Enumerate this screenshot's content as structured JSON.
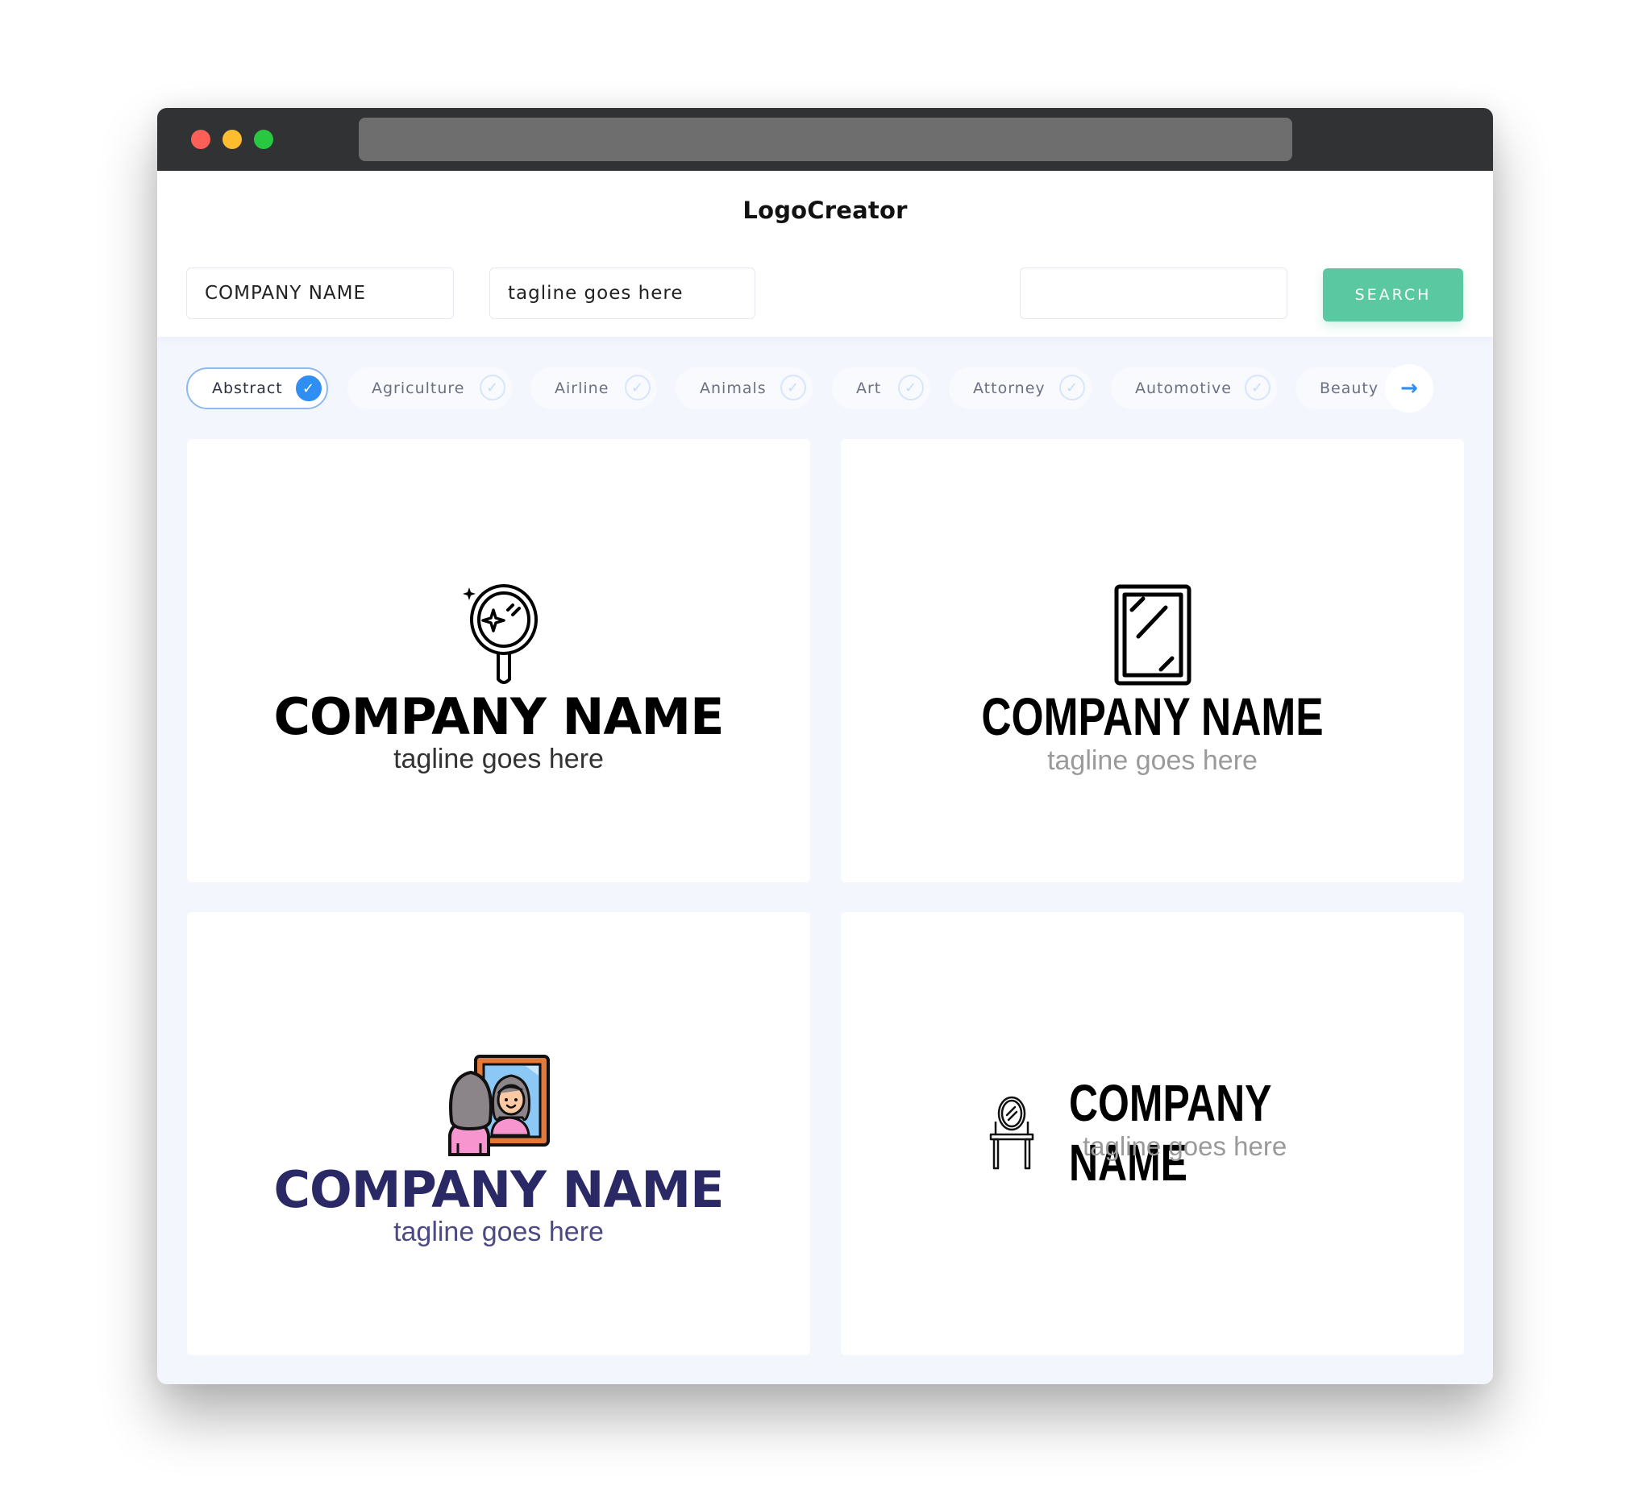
{
  "window": {
    "controls": [
      "close",
      "minimize",
      "maximize"
    ]
  },
  "header": {
    "brand": "LogoCreator"
  },
  "search": {
    "company_name_value": "COMPANY NAME",
    "tagline_value": "tagline goes here",
    "keyword_value": "",
    "search_label": "SEARCH"
  },
  "categories": {
    "items": [
      {
        "label": "Abstract",
        "selected": true
      },
      {
        "label": "Agriculture",
        "selected": false
      },
      {
        "label": "Airline",
        "selected": false
      },
      {
        "label": "Animals",
        "selected": false
      },
      {
        "label": "Art",
        "selected": false
      },
      {
        "label": "Attorney",
        "selected": false
      },
      {
        "label": "Automotive",
        "selected": false
      },
      {
        "label": "Beauty",
        "selected": false
      }
    ],
    "next_icon": "arrow-right-icon"
  },
  "logos": [
    {
      "icon": "hand-mirror-sparkle-icon",
      "company": "COMPANY NAME",
      "tagline": "tagline goes here",
      "color": "#000000"
    },
    {
      "icon": "wall-mirror-icon",
      "company": "COMPANY NAME",
      "tagline": "tagline goes here",
      "color": "#000000"
    },
    {
      "icon": "woman-mirror-reflection-icon",
      "company": "COMPANY NAME",
      "tagline": "tagline goes here",
      "color": "#2a2966"
    },
    {
      "icon": "vanity-table-icon",
      "company": "COMPANY NAME",
      "tagline": "tagline goes here",
      "color": "#000000"
    }
  ],
  "colors": {
    "accent": "#2f8ef2",
    "search_button": "#5ac9a1",
    "titlebar": "#313234"
  }
}
